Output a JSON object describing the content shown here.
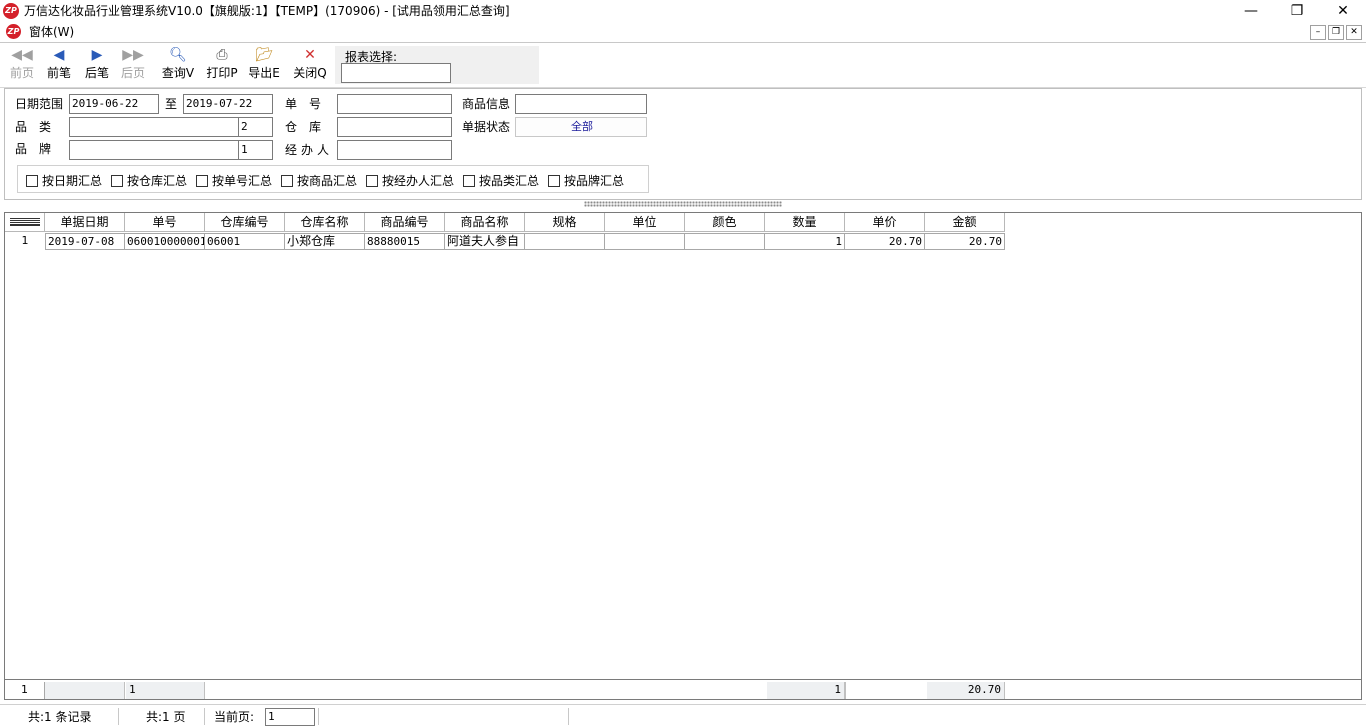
{
  "window": {
    "title": "万信达化妆品行业管理系统V10.0【旗舰版:1】【TEMP】(170906) - [试用品领用汇总查询]",
    "logo_text": "ZP",
    "menu_window": "窗体(W)",
    "minimize": "—",
    "restore": "❐",
    "close": "✕"
  },
  "toolbar": {
    "prev_page": "前页",
    "prev_record": "前笔",
    "next_record": "后笔",
    "next_page": "后页",
    "query": "查询V",
    "print": "打印P",
    "export": "导出E",
    "close": "关闭Q",
    "report_select_label": "报表选择:",
    "report_select_value": ""
  },
  "filter": {
    "date_range_label": "日期范围",
    "date_from": "2019-06-22",
    "date_to_label": "至",
    "date_to": "2019-07-22",
    "category_label": "品　类",
    "category_value": "",
    "category_code": "2",
    "brand_label": "品　牌",
    "brand_value": "",
    "brand_code": "1",
    "doc_no_label": "单　号",
    "doc_no_value": "",
    "warehouse_label": "仓　库",
    "warehouse_value": "",
    "handler_label": "经办人",
    "handler_value": "",
    "product_info_label": "商品信息",
    "product_info_value": "",
    "doc_status_label": "单据状态",
    "doc_status_value": "全部",
    "group_by": [
      {
        "label": "按日期汇总",
        "checked": false
      },
      {
        "label": "按仓库汇总",
        "checked": false
      },
      {
        "label": "按单号汇总",
        "checked": false
      },
      {
        "label": "按商品汇总",
        "checked": false
      },
      {
        "label": "按经办人汇总",
        "checked": false
      },
      {
        "label": "按品类汇总",
        "checked": false
      },
      {
        "label": "按品牌汇总",
        "checked": false
      }
    ]
  },
  "grid": {
    "columns": [
      "单据日期",
      "单号",
      "仓库编号",
      "仓库名称",
      "商品编号",
      "商品名称",
      "规格",
      "单位",
      "颜色",
      "数量",
      "单价",
      "金额"
    ],
    "rows": [
      {
        "index": "1",
        "cells": [
          "2019-07-08",
          "060010000001",
          "06001",
          "小郑仓库",
          "88880015",
          "阿道夫人参自",
          "",
          "",
          "",
          "1",
          "20.70",
          "20.70"
        ]
      }
    ],
    "footer": {
      "index": "1",
      "doc_count": "1",
      "qty_total": "1",
      "amount_total": "20.70"
    }
  },
  "status": {
    "total_records": "共:1 条记录",
    "total_pages": "共:1 页",
    "current_page_label": "当前页:",
    "current_page": "1"
  }
}
